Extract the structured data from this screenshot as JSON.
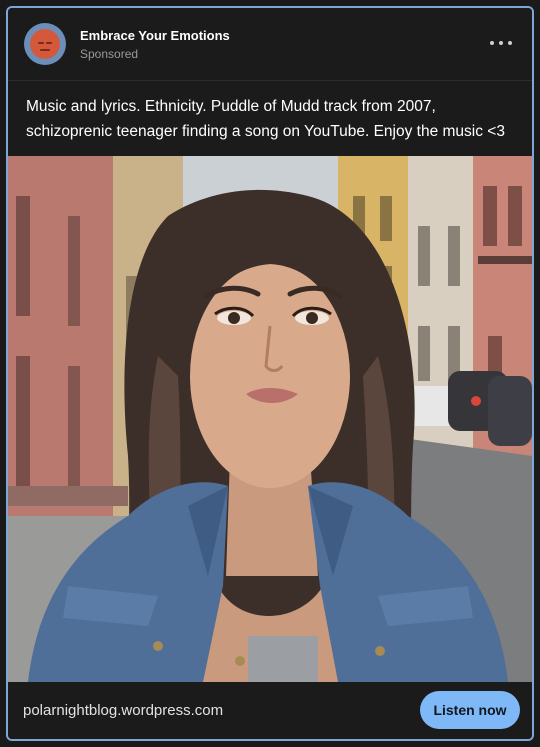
{
  "post": {
    "blog_name": "Embrace Your Emotions",
    "sponsored_label": "Sponsored",
    "more_icon": "more-horizontal-icon",
    "caption": "Music and lyrics. Ethnicity. Puddle of Mudd track from 2007, schizoprenic teenager finding a song on YouTube. Enjoy the music <3"
  },
  "footer": {
    "link_url": "polarnightblog.wordpress.com",
    "cta_label": "Listen now"
  },
  "colors": {
    "card_border": "#7ea7d6",
    "cta_background": "#7fb8f7",
    "background": "#1b1b1b"
  }
}
